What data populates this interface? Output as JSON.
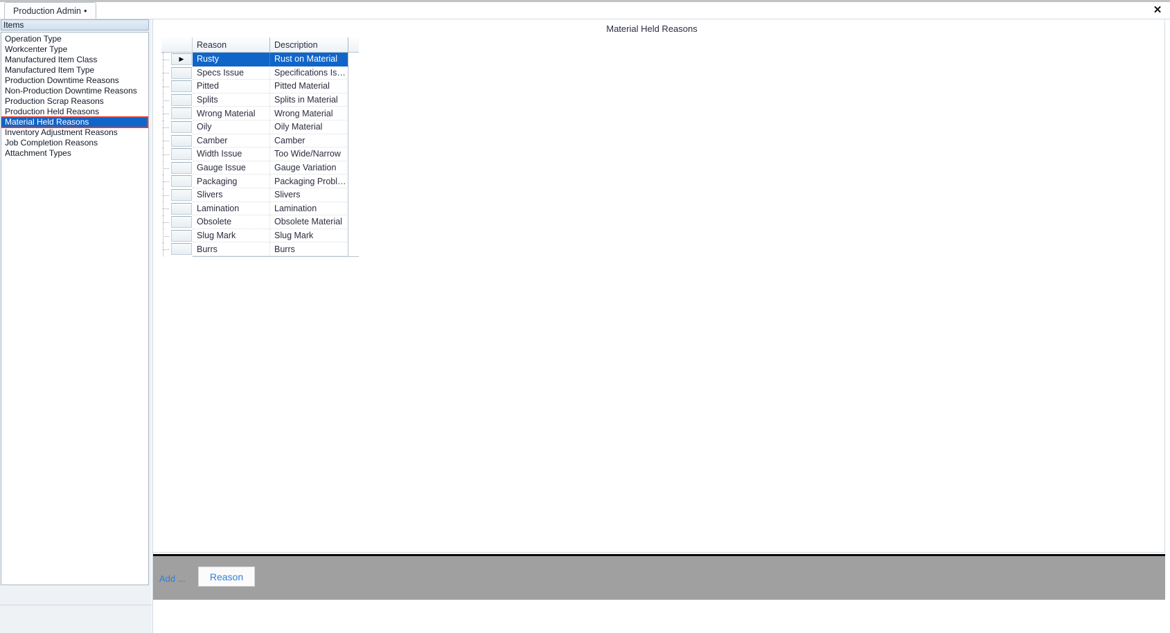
{
  "window": {
    "tab_label": "Production Admin",
    "tab_modified_marker": "•",
    "close_label": "✕"
  },
  "sidebar": {
    "header": "Items",
    "items": [
      {
        "label": "Operation Type",
        "selected": false
      },
      {
        "label": "Workcenter Type",
        "selected": false
      },
      {
        "label": "Manufactured Item Class",
        "selected": false
      },
      {
        "label": "Manufactured Item Type",
        "selected": false
      },
      {
        "label": "Production Downtime Reasons",
        "selected": false
      },
      {
        "label": "Non-Production Downtime Reasons",
        "selected": false
      },
      {
        "label": "Production Scrap Reasons",
        "selected": false
      },
      {
        "label": "Production Held Reasons",
        "selected": false
      },
      {
        "label": "Material Held Reasons",
        "selected": true
      },
      {
        "label": "Inventory Adjustment Reasons",
        "selected": false
      },
      {
        "label": "Job Completion Reasons",
        "selected": false
      },
      {
        "label": "Attachment Types",
        "selected": false
      }
    ]
  },
  "main": {
    "title": "Material Held Reasons",
    "grid": {
      "columns": [
        "Reason",
        "Description"
      ],
      "rows": [
        {
          "reason": "Rusty",
          "description": "Rust on Material",
          "selected": true,
          "current": true
        },
        {
          "reason": "Specs Issue",
          "description": "Specifications Is…",
          "selected": false,
          "current": false
        },
        {
          "reason": "Pitted",
          "description": "Pitted Material",
          "selected": false,
          "current": false
        },
        {
          "reason": "Splits",
          "description": "Splits in Material",
          "selected": false,
          "current": false
        },
        {
          "reason": "Wrong Material",
          "description": "Wrong Material",
          "selected": false,
          "current": false
        },
        {
          "reason": "Oily",
          "description": "Oily Material",
          "selected": false,
          "current": false
        },
        {
          "reason": "Camber",
          "description": "Camber",
          "selected": false,
          "current": false
        },
        {
          "reason": "Width Issue",
          "description": "Too Wide/Narrow",
          "selected": false,
          "current": false
        },
        {
          "reason": "Gauge Issue",
          "description": "Gauge Variation",
          "selected": false,
          "current": false
        },
        {
          "reason": "Packaging",
          "description": "Packaging  Probl…",
          "selected": false,
          "current": false
        },
        {
          "reason": "Slivers",
          "description": "Slivers",
          "selected": false,
          "current": false
        },
        {
          "reason": "Lamination",
          "description": "Lamination",
          "selected": false,
          "current": false
        },
        {
          "reason": "Obsolete",
          "description": "Obsolete Material",
          "selected": false,
          "current": false
        },
        {
          "reason": "Slug Mark",
          "description": "Slug Mark",
          "selected": false,
          "current": false
        },
        {
          "reason": "Burrs",
          "description": "Burrs",
          "selected": false,
          "current": false
        }
      ]
    }
  },
  "toolbar": {
    "add_label": "Add ...",
    "reason_button": "Reason"
  },
  "colors": {
    "selection_blue": "#1065c8",
    "focus_red": "#e8392e",
    "link_blue": "#2f7fd8",
    "toolbar_gray": "#a0a0a0"
  }
}
